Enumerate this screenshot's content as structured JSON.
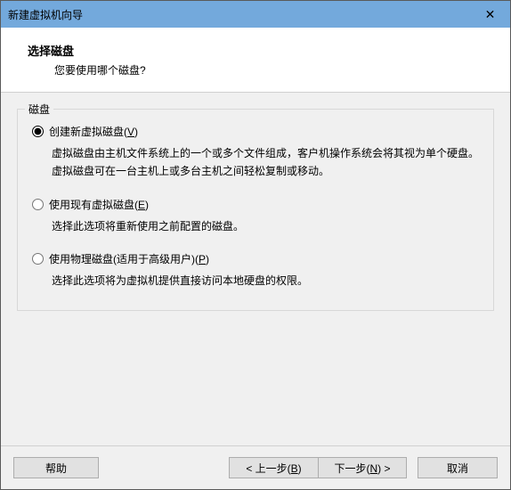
{
  "titlebar": {
    "title": "新建虚拟机向导",
    "close": "✕"
  },
  "header": {
    "title": "选择磁盘",
    "subtitle": "您要使用哪个磁盘?"
  },
  "fieldset": {
    "legend": "磁盘"
  },
  "options": {
    "create": {
      "label_pre": "创建新虚拟磁盘(",
      "mnemonic": "V",
      "label_post": ")",
      "desc": "虚拟磁盘由主机文件系统上的一个或多个文件组成，客户机操作系统会将其视为单个硬盘。虚拟磁盘可在一台主机上或多台主机之间轻松复制或移动。",
      "checked": true
    },
    "existing": {
      "label_pre": "使用现有虚拟磁盘(",
      "mnemonic": "E",
      "label_post": ")",
      "desc": "选择此选项将重新使用之前配置的磁盘。",
      "checked": false
    },
    "physical": {
      "label_pre": "使用物理磁盘(适用于高级用户)(",
      "mnemonic": "P",
      "label_post": ")",
      "desc": "选择此选项将为虚拟机提供直接访问本地硬盘的权限。",
      "checked": false
    }
  },
  "footer": {
    "help": "帮助",
    "back_pre": "< 上一步(",
    "back_m": "B",
    "back_post": ")",
    "next_pre": "下一步(",
    "next_m": "N",
    "next_post": ") >",
    "cancel": "取消"
  }
}
